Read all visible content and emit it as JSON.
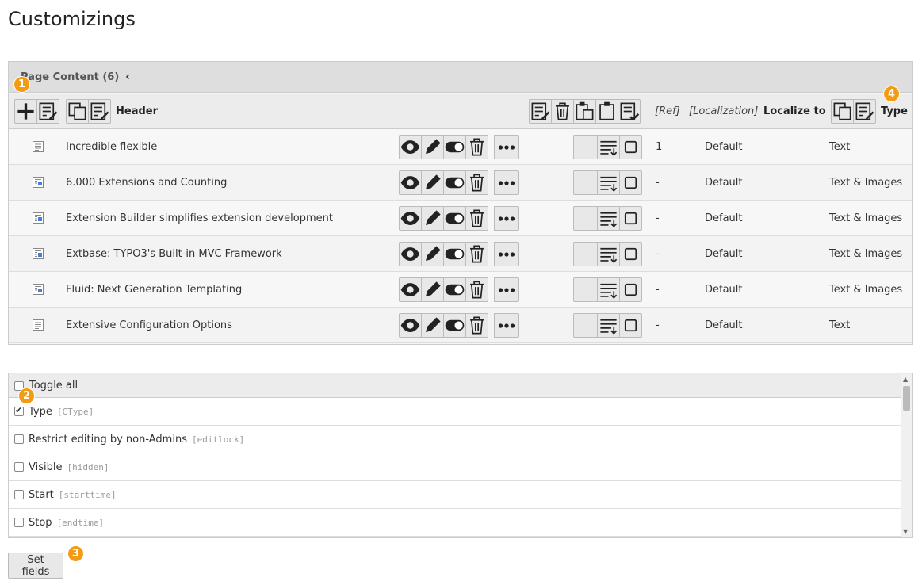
{
  "page": {
    "title": "Customizings"
  },
  "panel": {
    "heading": "Page Content (6)"
  },
  "header": {
    "header_label": "Header",
    "ref_label": "[Ref]",
    "localization_label": "[Localization]",
    "localize_to_label": "Localize to",
    "type_label": "Type"
  },
  "rows": [
    {
      "title": "Incredible flexible",
      "ref": "1",
      "localization": "Default",
      "type": "Text",
      "icon": "text-content-icon"
    },
    {
      "title": "6.000 Extensions and Counting",
      "ref": "-",
      "localization": "Default",
      "type": "Text & Images",
      "icon": "textpic-content-icon"
    },
    {
      "title": "Extension Builder simplifies extension development",
      "ref": "-",
      "localization": "Default",
      "type": "Text & Images",
      "icon": "textpic-content-icon"
    },
    {
      "title": "Extbase: TYPO3's Built-in MVC Framework",
      "ref": "-",
      "localization": "Default",
      "type": "Text & Images",
      "icon": "textpic-content-icon"
    },
    {
      "title": "Fluid: Next Generation Templating",
      "ref": "-",
      "localization": "Default",
      "type": "Text & Images",
      "icon": "textpic-content-icon"
    },
    {
      "title": "Extensive Configuration Options",
      "ref": "-",
      "localization": "Default",
      "type": "Text",
      "icon": "text-content-icon"
    }
  ],
  "fields": {
    "toggle_all": "Toggle all",
    "items": [
      {
        "label": "Type",
        "key": "[CType]",
        "checked": true
      },
      {
        "label": "Restrict editing by non-Admins",
        "key": "[editlock]",
        "checked": false
      },
      {
        "label": "Visible",
        "key": "[hidden]",
        "checked": false
      },
      {
        "label": "Start",
        "key": "[starttime]",
        "checked": false
      },
      {
        "label": "Stop",
        "key": "[endtime]",
        "checked": false
      }
    ]
  },
  "actions": {
    "set_fields": "Set fields"
  },
  "badges": [
    "1",
    "2",
    "3",
    "4"
  ],
  "colors": {
    "badge": "#f39c12"
  }
}
